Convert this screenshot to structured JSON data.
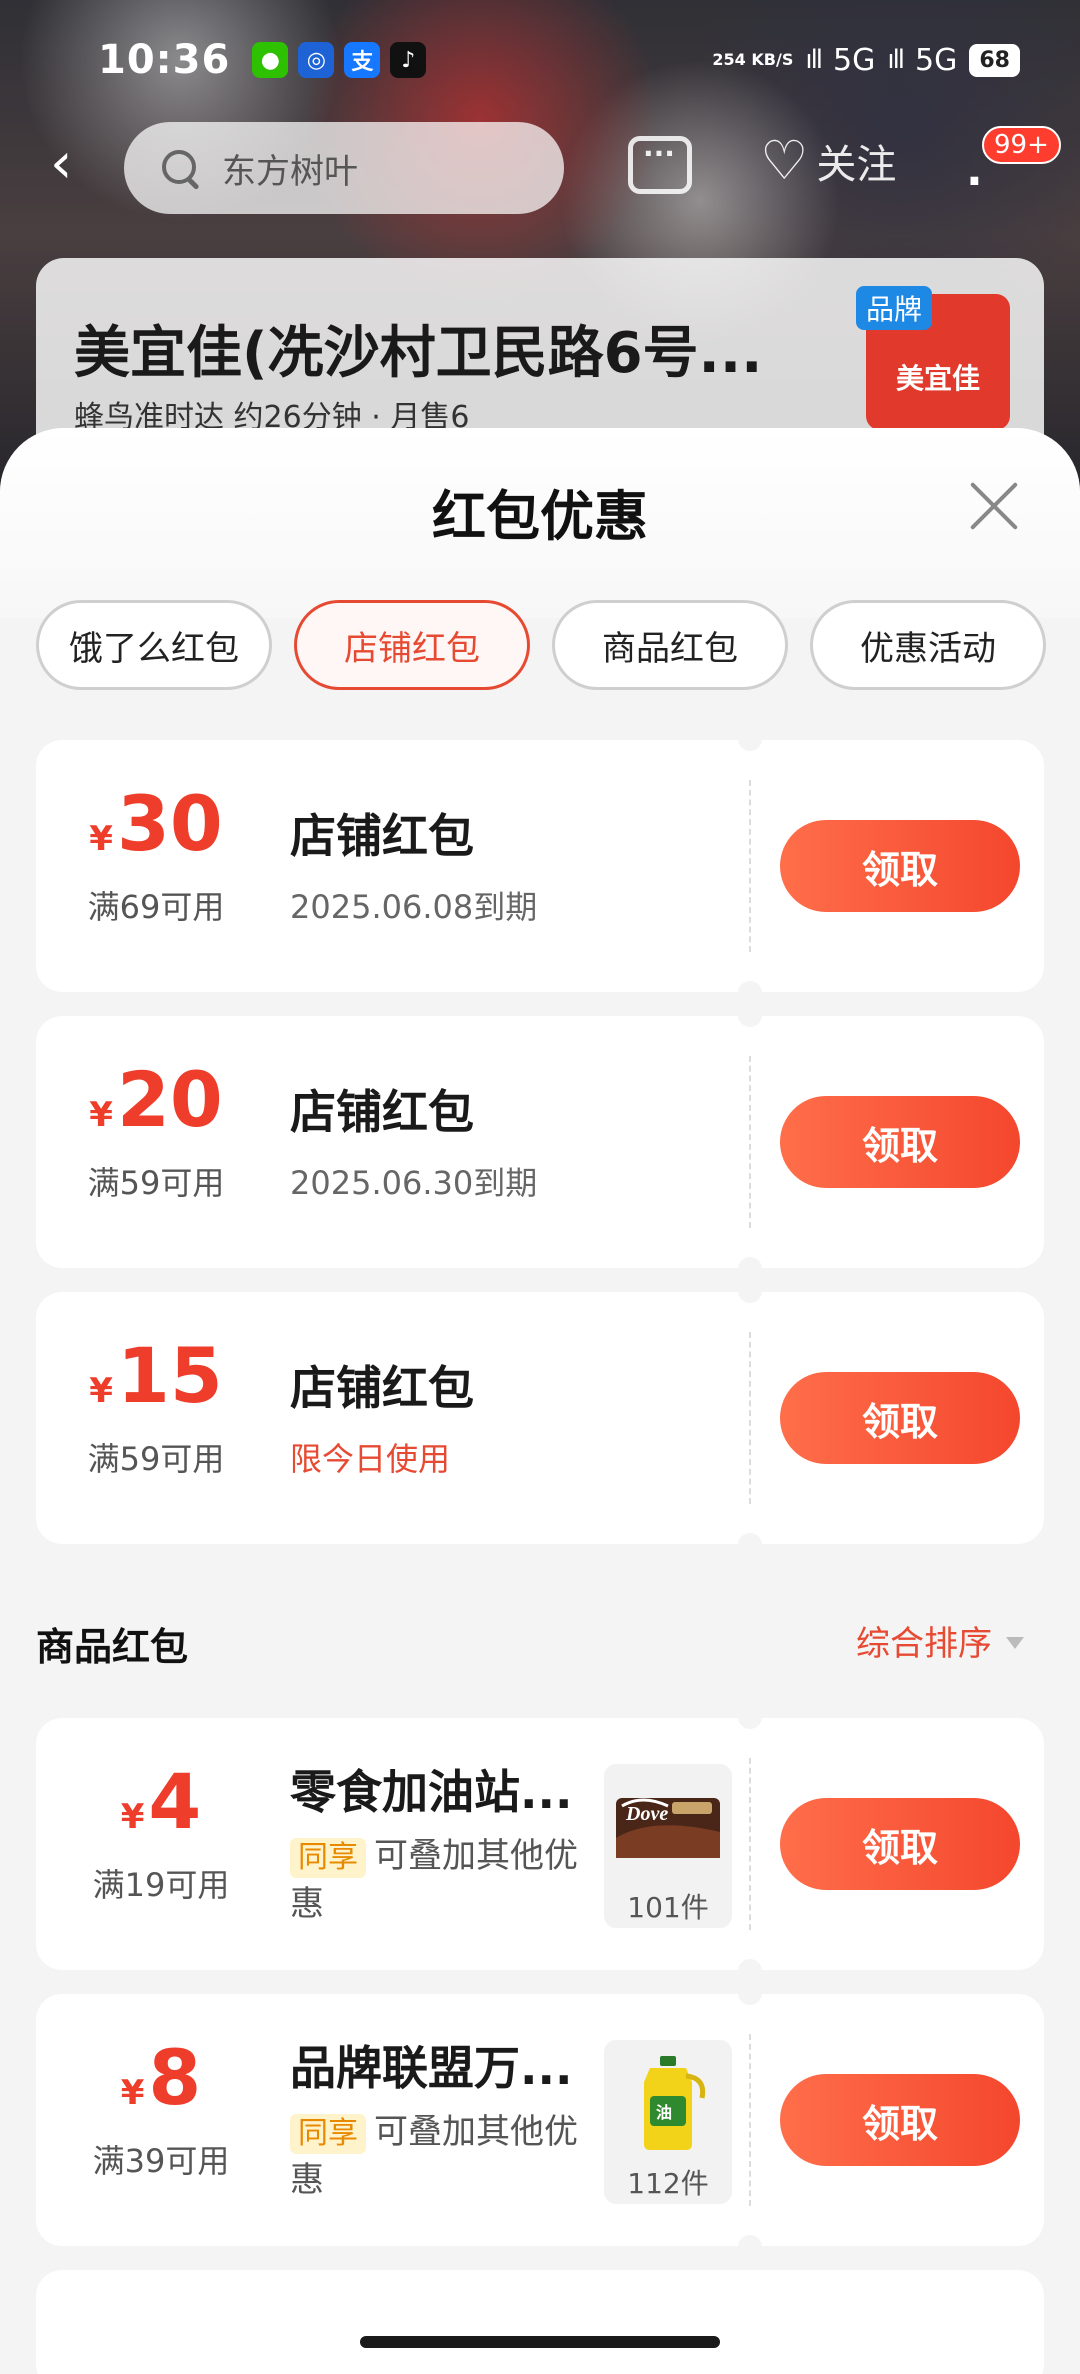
{
  "status_bar": {
    "time": "10:36",
    "apps": [
      {
        "icon": "wechat-icon",
        "label": "",
        "color": "#2dc100"
      },
      {
        "icon": "qq-browser-icon",
        "label": "",
        "color": "#1e63d6"
      },
      {
        "icon": "alipay-icon",
        "label": "支",
        "color": "#1677ff"
      },
      {
        "icon": "tiktok-icon",
        "label": "",
        "color": "#111111"
      }
    ],
    "net_speed": "254 KB/S",
    "network1": "5G",
    "network2": "5G",
    "battery": "68"
  },
  "header": {
    "search_placeholder": "东方树叶",
    "follow_label": "关注",
    "message_badge": "99+"
  },
  "store": {
    "name": "美宜佳(冼沙村卫民路6号...",
    "delivery": "蜂鸟准时达 约26分钟 · 月售6",
    "brand_tag": "品牌",
    "logo_text": "美宜佳"
  },
  "sheet": {
    "title": "红包优惠",
    "tabs": [
      {
        "label": "饿了么红包",
        "active": false
      },
      {
        "label": "店铺红包",
        "active": true
      },
      {
        "label": "商品红包",
        "active": false
      },
      {
        "label": "优惠活动",
        "active": false
      }
    ],
    "store_coupons": [
      {
        "currency": "¥",
        "amount": "30",
        "condition": "满69可用",
        "title": "店铺红包",
        "expiry": "2025.06.08到期",
        "button": "领取"
      },
      {
        "currency": "¥",
        "amount": "20",
        "condition": "满59可用",
        "title": "店铺红包",
        "expiry": "2025.06.30到期",
        "button": "领取"
      },
      {
        "currency": "¥",
        "amount": "15",
        "condition": "满59可用",
        "title": "店铺红包",
        "expiry": "限今日使用",
        "button": "领取"
      }
    ],
    "goods_section": {
      "title": "商品红包",
      "sort_label": "综合排序"
    },
    "goods_coupons": [
      {
        "currency": "¥",
        "amount": "4",
        "condition": "满19可用",
        "title": "零食加油站...",
        "tag": "同享",
        "desc": "可叠加其他优惠",
        "count": "101件",
        "thumb_icon": "dove-chocolate-icon",
        "button": "领取"
      },
      {
        "currency": "¥",
        "amount": "8",
        "condition": "满39可用",
        "title": "品牌联盟万...",
        "tag": "同享",
        "desc": "可叠加其他优惠",
        "count": "112件",
        "thumb_icon": "cooking-oil-bottle-icon",
        "button": "领取"
      }
    ]
  },
  "colors": {
    "accent": "#e74a32",
    "button_start": "#ff6e4a",
    "button_end": "#f4472e",
    "tag_bg": "#fff3cc",
    "tag_text": "#e78a00"
  }
}
